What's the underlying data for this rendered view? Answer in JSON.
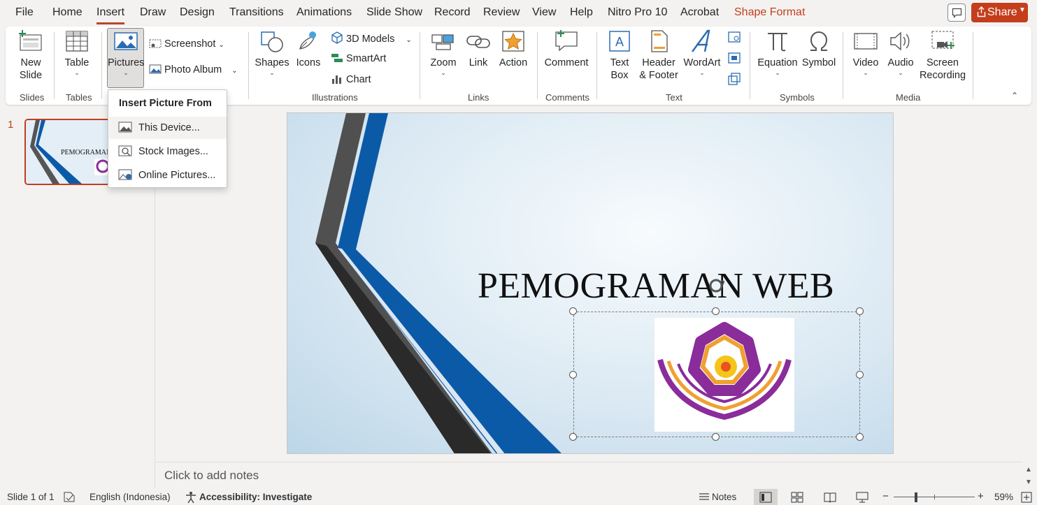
{
  "menu": {
    "items": [
      "File",
      "Home",
      "Insert",
      "Draw",
      "Design",
      "Transitions",
      "Animations",
      "Slide Show",
      "Record",
      "Review",
      "View",
      "Help",
      "Nitro Pro 10",
      "Acrobat",
      "Shape Format"
    ],
    "share": "Share"
  },
  "ribbon": {
    "new_slide": "New Slide",
    "new_slide_line1": "New",
    "new_slide_line2": "Slide",
    "table": "Table",
    "pictures": "Pictures",
    "screenshot": "Screenshot",
    "photo_album": "Photo Album",
    "shapes": "Shapes",
    "icons": "Icons",
    "models_3d": "3D Models",
    "smartart": "SmartArt",
    "chart": "Chart",
    "zoom": "Zoom",
    "link": "Link",
    "action": "Action",
    "comment": "Comment",
    "text_box_line1": "Text",
    "text_box_line2": "Box",
    "header_line1": "Header",
    "header_line2": "& Footer",
    "wordart": "WordArt",
    "equation": "Equation",
    "symbol": "Symbol",
    "video": "Video",
    "audio": "Audio",
    "screen_rec_line1": "Screen",
    "screen_rec_line2": "Recording",
    "groups": {
      "slides": "Slides",
      "tables": "Tables",
      "illustrations": "Illustrations",
      "links": "Links",
      "comments": "Comments",
      "text": "Text",
      "symbols": "Symbols",
      "media": "Media"
    }
  },
  "dropdown": {
    "title": "Insert Picture From",
    "items": [
      "This Device...",
      "Stock Images...",
      "Online Pictures..."
    ]
  },
  "slides_pane": {
    "number": "1",
    "thumb_title": "PEMOGRAMAN"
  },
  "slide": {
    "title": "PEMOGRAMAN WEB"
  },
  "notes": {
    "placeholder": "Click to add notes"
  },
  "status": {
    "slide_info": "Slide 1 of 1",
    "language": "English (Indonesia)",
    "accessibility": "Accessibility: Investigate",
    "notes": "Notes",
    "zoom": "59%"
  },
  "colors": {
    "accent": "#c43e1c",
    "ribbon_bg": "#ffffff",
    "app_bg": "#f3f2f1",
    "slide_blue": "#0b5aa8",
    "slide_gray": "#3a3a3a"
  }
}
